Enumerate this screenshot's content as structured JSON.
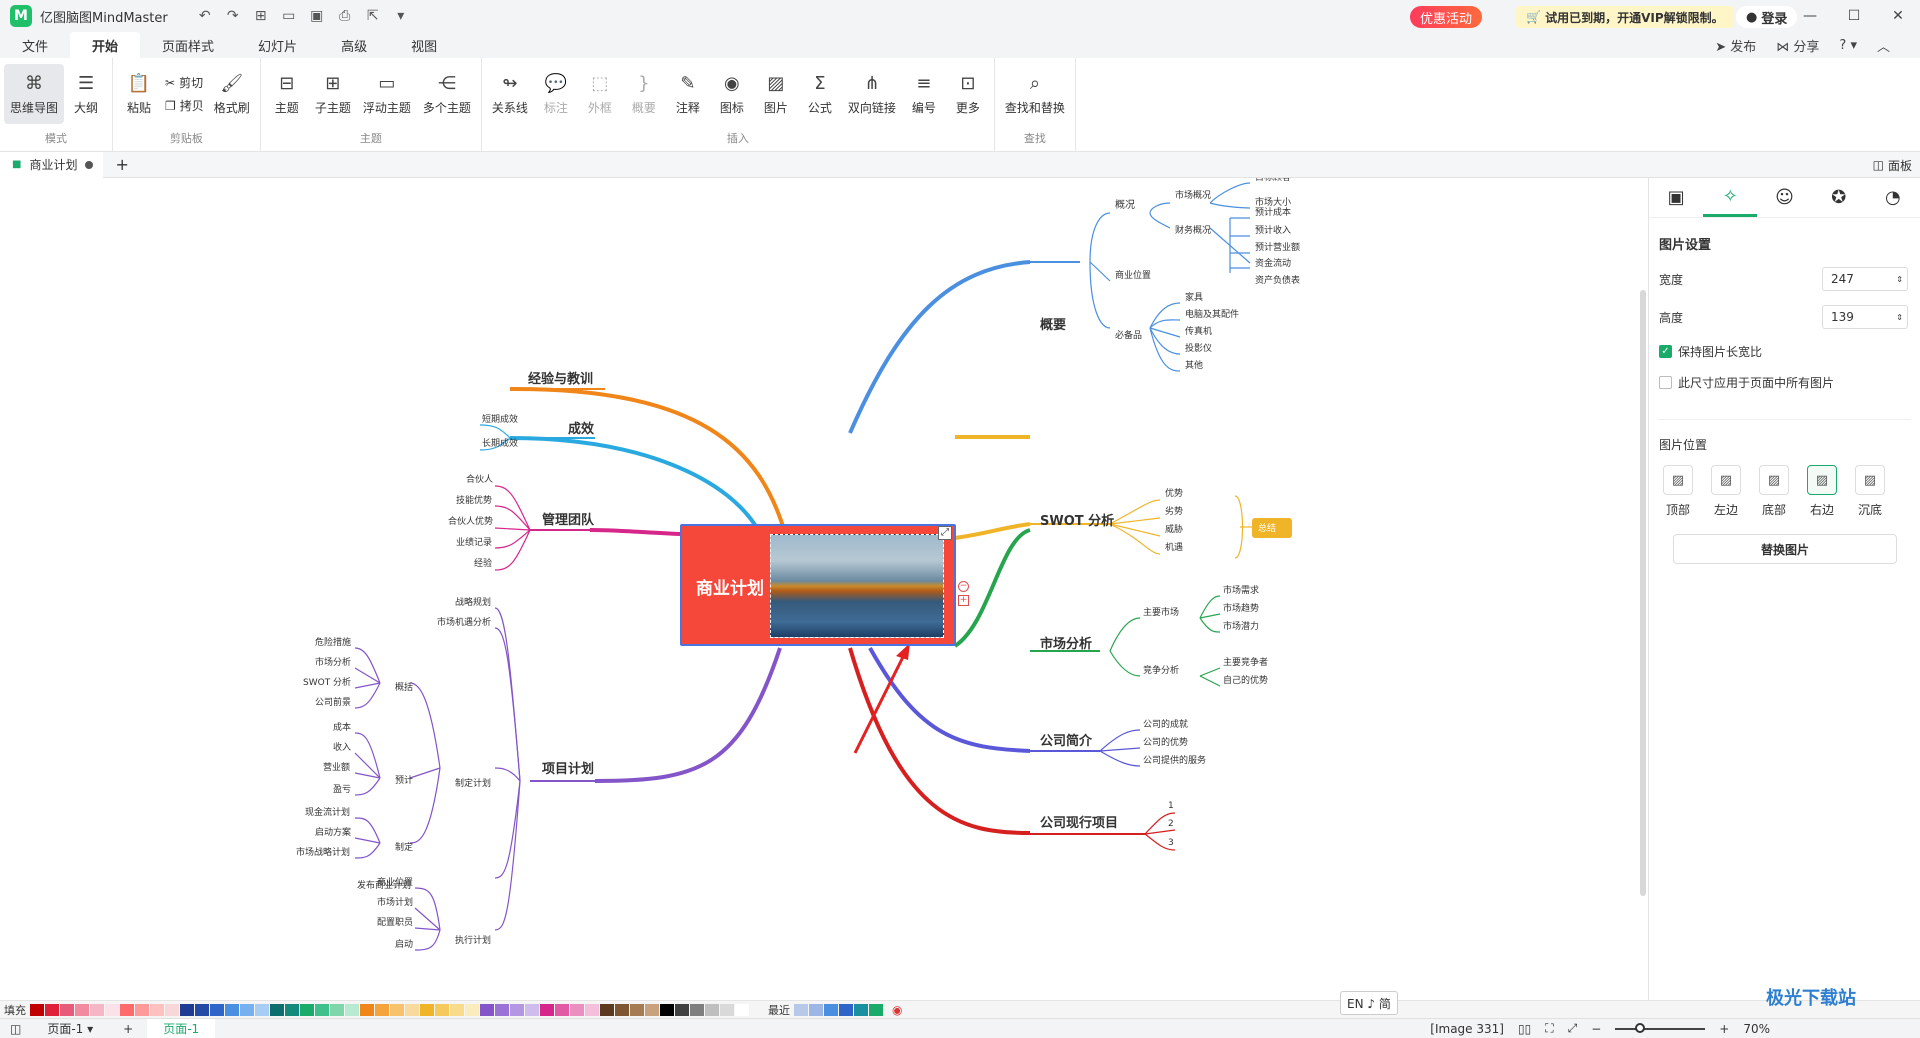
{
  "app": {
    "title": "亿图脑图MindMaster",
    "logo_letter": "M"
  },
  "titlebar": {
    "promo": "优惠活动",
    "trial": "试用已到期，开通VIP解锁限制。",
    "login": "登录"
  },
  "menu": {
    "items": [
      "文件",
      "开始",
      "页面样式",
      "幻灯片",
      "高级",
      "视图"
    ],
    "active": "开始",
    "publish": "发布",
    "share": "分享"
  },
  "ribbon": {
    "mode": {
      "mindmap": "思维导图",
      "outline": "大纲",
      "group": "模式"
    },
    "clipboard": {
      "paste": "粘贴",
      "cut": "剪切",
      "copy": "拷贝",
      "format_painter": "格式刷",
      "group": "剪贴板"
    },
    "topic": {
      "topic": "主题",
      "subtopic": "子主题",
      "floating": "浮动主题",
      "multi": "多个主题",
      "group": "主题"
    },
    "insert": {
      "relation": "关系线",
      "callout": "标注",
      "boundary": "外框",
      "summary": "概要",
      "note": "注释",
      "icon": "图标",
      "image": "图片",
      "formula": "公式",
      "bilink": "双向链接",
      "numbering": "编号",
      "more": "更多",
      "group": "插入"
    },
    "find": {
      "find_replace": "查找和替换",
      "group": "查找"
    }
  },
  "doctab": {
    "name": "商业计划",
    "panel": "面板"
  },
  "mindmap": {
    "central": "商业计划",
    "right": {
      "overview": {
        "label": "概要",
        "market": "市场概况",
        "target": "目标顾客",
        "size": "市场大小",
        "finance": "财务概况",
        "f_items": [
          "预计成本",
          "预计收入",
          "预计营业额",
          "资金流动",
          "资产负债表"
        ],
        "general": "概况",
        "location": "商业位置",
        "essentials": "必备品",
        "e_items": [
          "家具",
          "电脑及其配件",
          "传真机",
          "投影仪",
          "其他"
        ]
      },
      "swot": {
        "label": "SWOT 分析",
        "items": [
          "优势",
          "劣势",
          "威胁",
          "机遇"
        ],
        "summary": "总结"
      },
      "market": {
        "label": "市场分析",
        "main": "主要市场",
        "m_items": [
          "市场需求",
          "市场趋势",
          "市场潜力"
        ],
        "comp": "竞争分析",
        "c_items": [
          "主要竞争者",
          "自己的优势"
        ]
      },
      "company": {
        "label": "公司简介",
        "items": [
          "公司的成就",
          "公司的优势",
          "公司提供的服务"
        ]
      },
      "current": {
        "label": "公司现行项目",
        "items": [
          "1",
          "2",
          "3"
        ]
      }
    },
    "left": {
      "lessons": {
        "label": "经验与教训"
      },
      "results": {
        "label": "成效",
        "items": [
          "短期成效",
          "长期成效"
        ]
      },
      "team": {
        "label": "管理团队",
        "items": [
          "合伙人",
          "技能优势",
          "合伙人优势",
          "业绩记录",
          "经验"
        ]
      },
      "project": {
        "label": "项目计划",
        "strategy": "战略规划",
        "opportunity": "市场机遇分析",
        "plan": "制定计划",
        "overview": "概括",
        "o_items": [
          "危险措施",
          "市场分析",
          "SWOT 分析",
          "公司前景"
        ],
        "forecast": "预计",
        "p_items": [
          "成本",
          "收入",
          "营业额",
          "盈亏"
        ],
        "make": "制定",
        "k_items": [
          "现金流计划",
          "启动方案",
          "市场战略计划"
        ],
        "publish": "发布商业计划",
        "exec": "执行计划",
        "x_items": [
          "商业位置",
          "市场计划",
          "配置职员",
          "启动"
        ]
      }
    }
  },
  "panel": {
    "title": "图片设置",
    "width_label": "宽度",
    "width": "247",
    "height_label": "高度",
    "height": "139",
    "keep_ratio": "保持图片长宽比",
    "apply_all": "此尺寸应用于页面中所有图片",
    "position_title": "图片位置",
    "positions": [
      "顶部",
      "左边",
      "底部",
      "右边",
      "沉底"
    ],
    "active_position": "右边",
    "replace": "替换图片"
  },
  "palette": {
    "fill": "填充",
    "recent": "最近",
    "ime": "EN ♪ 简"
  },
  "status": {
    "page_tab": "页面-1",
    "page_tab_active": "页面-1",
    "info": "[Image 331]",
    "zoom": "70%"
  },
  "watermark": "极光下载站"
}
